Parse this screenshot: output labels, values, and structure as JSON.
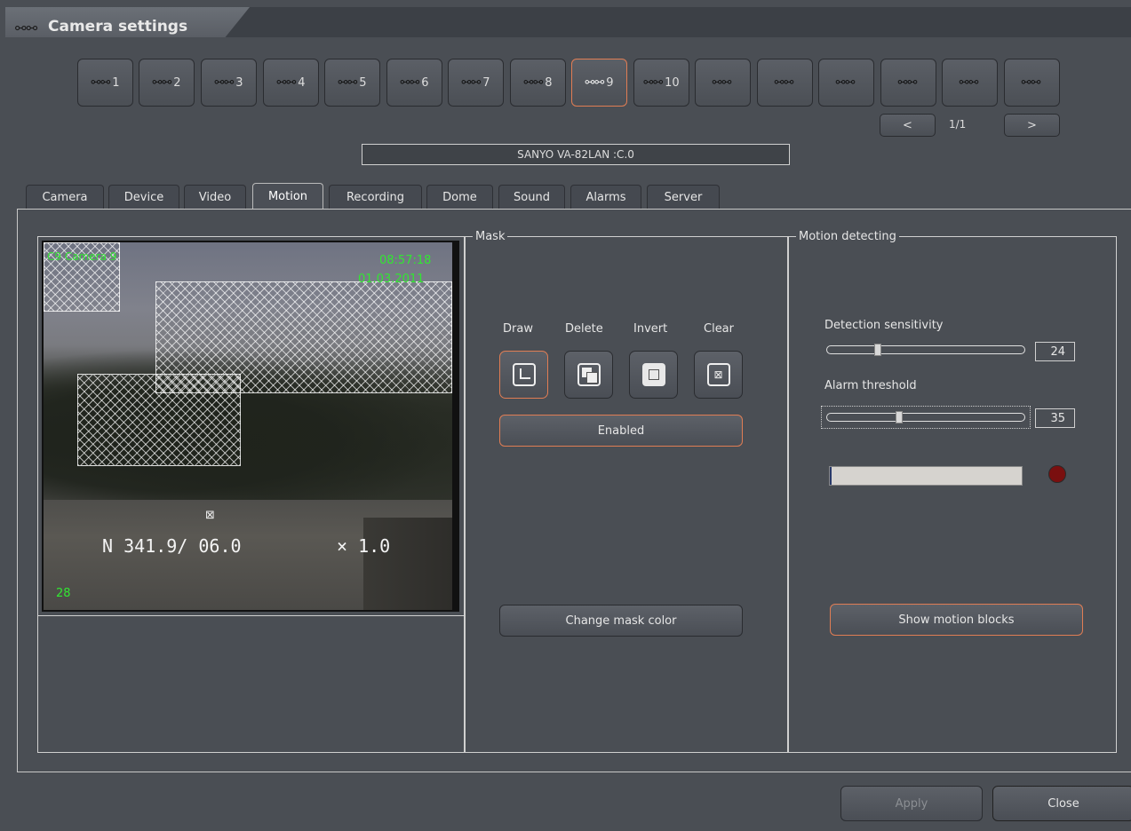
{
  "window": {
    "title": "Camera settings",
    "title_icon": "camera-group-icon"
  },
  "cameras": [
    {
      "label": "1",
      "selected": false
    },
    {
      "label": "2",
      "selected": false
    },
    {
      "label": "3",
      "selected": false
    },
    {
      "label": "4",
      "selected": false
    },
    {
      "label": "5",
      "selected": false
    },
    {
      "label": "6",
      "selected": false
    },
    {
      "label": "7",
      "selected": false
    },
    {
      "label": "8",
      "selected": false
    },
    {
      "label": "9",
      "selected": true
    },
    {
      "label": "10",
      "selected": false
    },
    {
      "label": "",
      "selected": false
    },
    {
      "label": "",
      "selected": false
    },
    {
      "label": "",
      "selected": false
    },
    {
      "label": "",
      "selected": false
    },
    {
      "label": "",
      "selected": false
    },
    {
      "label": "",
      "selected": false
    }
  ],
  "pager": {
    "prev": "<",
    "page": "1/1",
    "next": ">"
  },
  "device_name": "SANYO VA-82LAN :C.0",
  "tabs": [
    "Camera",
    "Device",
    "Video",
    "Motion",
    "Recording",
    "Dome",
    "Sound",
    "Alarms",
    "Server"
  ],
  "active_tab": "Motion",
  "preview": {
    "camera_name": "C9 Camera 9",
    "time": "08:57:18",
    "date": "01.03.2011",
    "position": "N 341.9/ 06.0",
    "zoom": "× 1.0",
    "counter": "28",
    "marker": "⊠"
  },
  "mask": {
    "group_label": "Mask",
    "tools": [
      "Draw",
      "Delete",
      "Invert",
      "Clear"
    ],
    "enabled_label": "Enabled",
    "change_color_label": "Change mask color"
  },
  "motion": {
    "group_label": "Motion detecting",
    "sensitivity_label": "Detection sensitivity",
    "sensitivity_value": "24",
    "sensitivity_fraction": 0.24,
    "threshold_label": "Alarm threshold",
    "threshold_value": "35",
    "threshold_fraction": 0.35,
    "level_fraction": 0.01,
    "indicator_color": "#7a0f0f",
    "show_blocks_label": "Show motion blocks"
  },
  "footer": {
    "apply_label": "Apply",
    "close_label": "Close"
  },
  "colors": {
    "accent": "#e07d54",
    "overlay_text": "#32e632",
    "background": "#4a4e54"
  }
}
